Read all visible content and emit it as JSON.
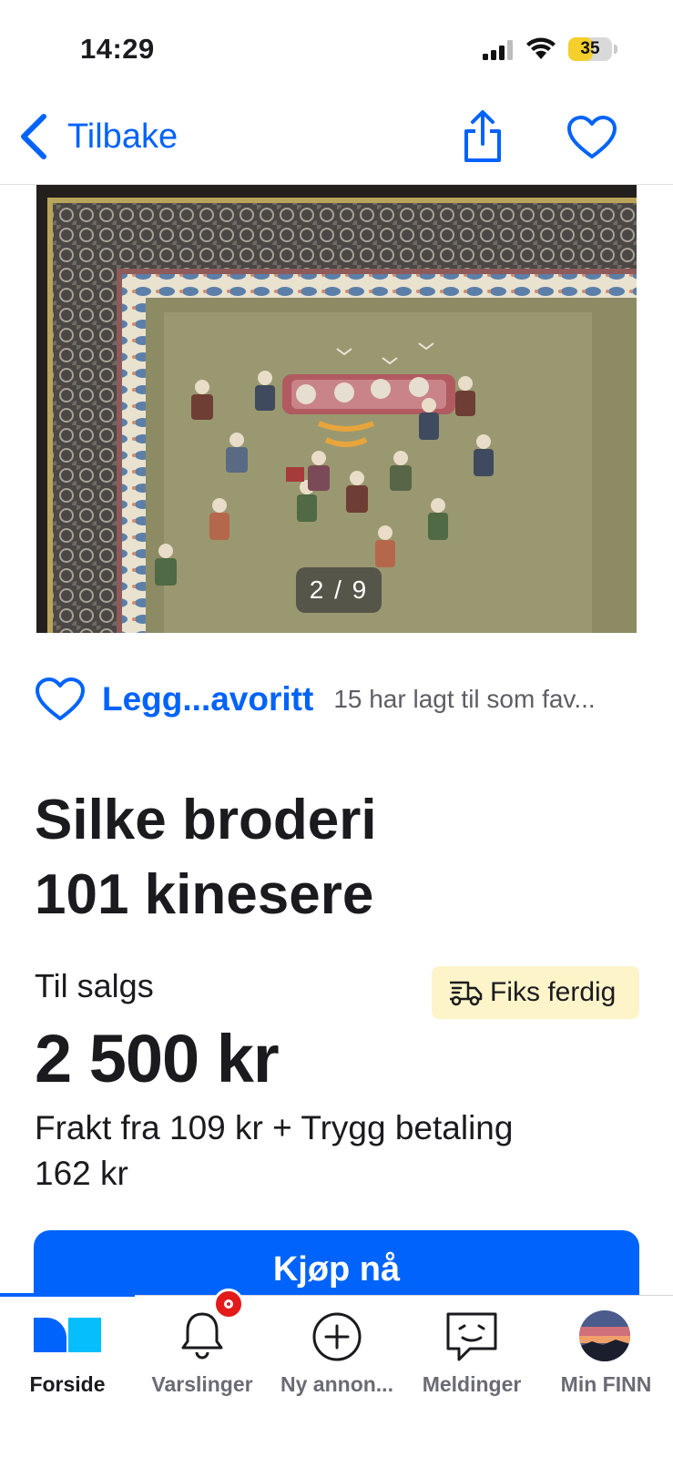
{
  "status_bar": {
    "time": "14:29",
    "battery_level": "35",
    "battery_fraction": 0.35,
    "icons": [
      "signal-icon",
      "wifi-icon",
      "battery-icon"
    ]
  },
  "nav": {
    "back_label": "Tilbake",
    "share_icon": "share-icon",
    "favorite_icon": "heart-outline-icon",
    "accent_color": "#0063fb"
  },
  "gallery": {
    "counter": "2 / 9",
    "current": 2,
    "total": 9
  },
  "favorite": {
    "label": "Legg...avoritt",
    "count_text": "15 har lagt til som fav..."
  },
  "listing": {
    "title_line1": "Silke broderi",
    "title_line2": "101 kinesere",
    "sale_label": "Til salgs",
    "badge_label": "Fiks ferdig",
    "badge_color": "#fdf4c9",
    "price": "2 500 kr",
    "shipping_line1": "Frakt fra 109 kr + Trygg betaling",
    "shipping_line2": "162 kr",
    "buy_label": "Kjøp nå"
  },
  "tab_bar": {
    "tabs": [
      {
        "label": "Forside",
        "icon": "home-icon",
        "active": true
      },
      {
        "label": "Varslinger",
        "icon": "bell-icon",
        "active": false,
        "badge": true
      },
      {
        "label": "Ny annon...",
        "icon": "plus-circle-icon",
        "active": false
      },
      {
        "label": "Meldinger",
        "icon": "chat-icon",
        "active": false
      },
      {
        "label": "Min FINN",
        "icon": "avatar",
        "active": false
      }
    ]
  }
}
